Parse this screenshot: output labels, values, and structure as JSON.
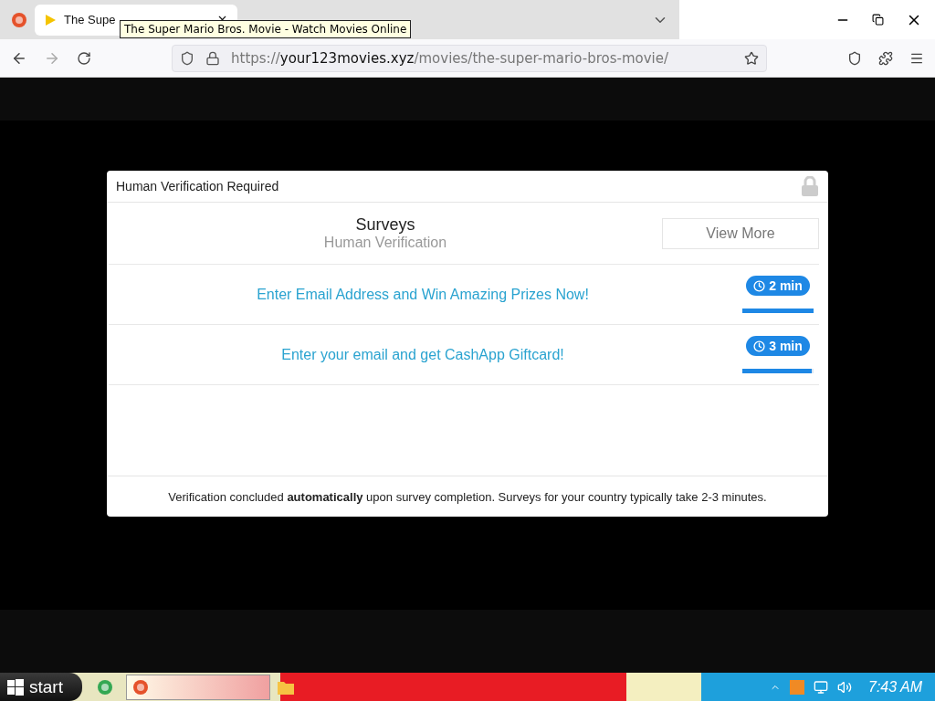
{
  "browser": {
    "tab": {
      "title": "The Supe",
      "selected": true
    },
    "tooltip": "The Super Mario Bros. Movie - Watch Movies Online",
    "url": {
      "host": "your123movies.xyz",
      "prefix": "https://",
      "path": "/movies/the-super-mario-bros-movie/"
    }
  },
  "modal": {
    "title": "Human Verification Required",
    "heading": "Surveys",
    "subheading": "Human Verification",
    "view_more": "View More",
    "offers": [
      {
        "text": "Enter Email Address and Win Amazing Prizes Now!",
        "time": "2 min",
        "level": 1.0
      },
      {
        "text": "Enter your email and get CashApp Giftcard!",
        "time": "3 min",
        "level": 0.97
      }
    ],
    "footer": "Verification concluded **automatically** upon survey completion. Surveys for your country typically take 2-3 minutes."
  },
  "taskbar": {
    "start": "start",
    "clock": "7:43 AM"
  }
}
